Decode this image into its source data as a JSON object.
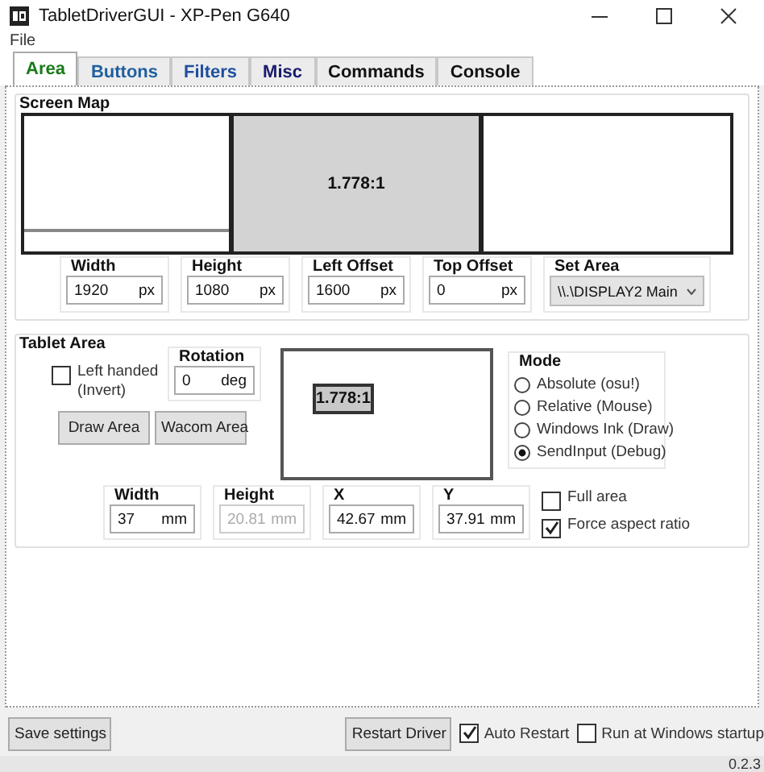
{
  "window": {
    "title": "TabletDriverGUI - XP-Pen G640"
  },
  "menu": [
    "File"
  ],
  "tabs": [
    {
      "label": "Area",
      "selected": true,
      "color": "#1a7a1a"
    },
    {
      "label": "Buttons",
      "selected": false,
      "color": "#1f5f9f"
    },
    {
      "label": "Filters",
      "selected": false,
      "color": "#1f4fa0"
    },
    {
      "label": "Misc",
      "selected": false,
      "color": "#1a1a6e"
    },
    {
      "label": "Commands",
      "selected": false,
      "color": "#111111"
    },
    {
      "label": "Console",
      "selected": false,
      "color": "#111111"
    }
  ],
  "screen_map": {
    "title": "Screen Map",
    "monitors": [
      {
        "selected": false
      },
      {
        "selected": true,
        "label": "1.778:1"
      },
      {
        "selected": false
      }
    ],
    "fields": [
      {
        "label": "Width",
        "value": "1920",
        "unit": "px",
        "disabled": false
      },
      {
        "label": "Height",
        "value": "1080",
        "unit": "px",
        "disabled": false
      },
      {
        "label": "Left Offset",
        "value": "1600",
        "unit": "px",
        "disabled": false
      },
      {
        "label": "Top Offset",
        "value": "0",
        "unit": "px",
        "disabled": false
      }
    ],
    "set_area": {
      "label": "Set Area",
      "value": "\\\\.\\DISPLAY2 Main"
    }
  },
  "tablet_area": {
    "title": "Tablet Area",
    "left_handed": {
      "label": "Left handed (Invert)",
      "checked": false
    },
    "rotation": {
      "label": "Rotation",
      "value": "0",
      "unit": "deg"
    },
    "buttons": [
      "Draw Area",
      "Wacom Area"
    ],
    "preview": {
      "label": "1.778:1"
    },
    "mode": {
      "title": "Mode",
      "options": [
        {
          "label": "Absolute (osu!)",
          "selected": false
        },
        {
          "label": "Relative (Mouse)",
          "selected": false
        },
        {
          "label": "Windows Ink (Draw)",
          "selected": false
        },
        {
          "label": "SendInput (Debug)",
          "selected": true
        }
      ]
    },
    "fields": [
      {
        "label": "Width",
        "value": "37",
        "unit": "mm",
        "disabled": false
      },
      {
        "label": "Height",
        "value": "20.81",
        "unit": "mm",
        "disabled": true
      },
      {
        "label": "X",
        "value": "42.67",
        "unit": "mm",
        "disabled": false
      },
      {
        "label": "Y",
        "value": "37.91",
        "unit": "mm",
        "disabled": false
      }
    ],
    "options": [
      {
        "label": "Full area",
        "checked": false
      },
      {
        "label": "Force aspect ratio",
        "checked": true
      }
    ]
  },
  "footer": {
    "save": "Save settings",
    "restart": "Restart Driver",
    "options": [
      {
        "label": "Auto Restart",
        "checked": true
      },
      {
        "label": "Run at Windows startup",
        "checked": false
      }
    ]
  },
  "status_bar": {
    "version": "0.2.3"
  }
}
